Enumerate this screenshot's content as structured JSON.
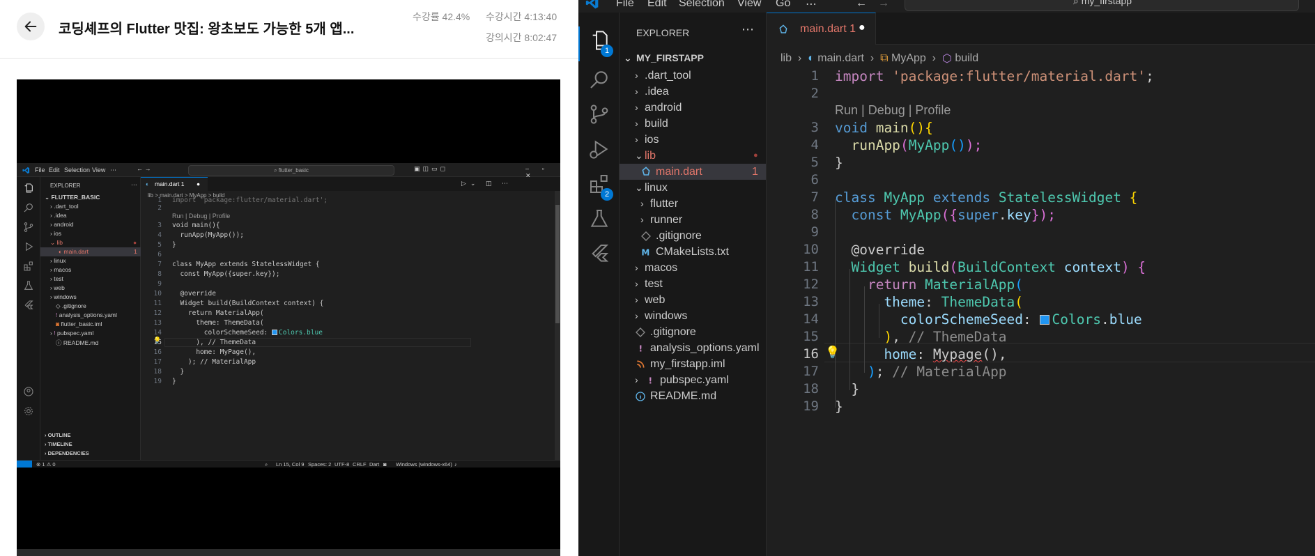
{
  "course": {
    "title": "코딩셰프의 Flutter 맛집: 왕초보도 가능한 5개 앱...",
    "progress_label": "수강률 42.4%",
    "watch_time_label": "수강시간 4:13:40",
    "lecture_time_label": "강의시간 8:02:47"
  },
  "video": {
    "menu": [
      "File",
      "Edit",
      "Selection",
      "View",
      "⋯"
    ],
    "search": "flutter_basic",
    "explorer_label": "EXPLORER",
    "project": "FLUTTER_BASIC",
    "tree": [
      ".dart_tool",
      ".idea",
      "android",
      "ios",
      "lib",
      "main.dart",
      "linux",
      "macos",
      "test",
      "web",
      "windows",
      ".gitignore",
      "analysis_options.yaml",
      "flutter_basic.iml",
      "pubspec.yaml",
      "README.md"
    ],
    "panels": [
      "OUTLINE",
      "TIMELINE",
      "DEPENDENCIES"
    ],
    "tab_label": "main.dart 1",
    "breadcrumb": "lib > main.dart > MyApp > build",
    "badge": "1",
    "codelens": "Run | Debug | Profile",
    "line_numbers": [
      "1",
      "2",
      "3",
      "4",
      "5",
      "6",
      "7",
      "8",
      "9",
      "10",
      "11",
      "12",
      "13",
      "14",
      "15",
      "16",
      "17",
      "18",
      "19"
    ],
    "code_top": "import 'package:flutter/material.dart';",
    "code": {
      "l3": "void main(){",
      "l4": "  runApp(MyApp());",
      "l5": "}",
      "l7": "class MyApp extends StatelessWidget {",
      "l8": "  const MyApp({super.key});",
      "l10": "  @override",
      "l11": "  Widget build(BuildContext context) {",
      "l12": "    return MaterialApp(",
      "l13": "      theme: ThemeData(",
      "l14a": "        colorSchemeSeed: ",
      "l14b": "Colors.blue",
      "l15": "      ), // ThemeData",
      "l16": "      home: MyPage(),",
      "l17": "    ); // MaterialApp",
      "l18": "  }",
      "l19": "}"
    },
    "status": {
      "errors": "⊗ 1 ⚠ 0",
      "position": "Ln 15, Col 9",
      "spaces": "Spaces: 2",
      "encoding": "UTF-8",
      "eol": "CRLF",
      "language": "Dart",
      "platform": "Windows (windows-x64)"
    }
  },
  "editor": {
    "menu": [
      "File",
      "Edit",
      "Selection",
      "View",
      "Go",
      "⋯"
    ],
    "search": "my_firstapp",
    "explorer_label": "EXPLORER",
    "project": "MY_FIRSTAPP",
    "tree": [
      {
        "label": ".dart_tool",
        "type": "folder",
        "depth": 1
      },
      {
        "label": ".idea",
        "type": "folder",
        "depth": 1
      },
      {
        "label": "android",
        "type": "folder",
        "depth": 1
      },
      {
        "label": "build",
        "type": "folder",
        "depth": 1
      },
      {
        "label": "ios",
        "type": "folder",
        "depth": 1
      },
      {
        "label": "lib",
        "type": "folder-open",
        "depth": 1
      },
      {
        "label": "main.dart",
        "type": "dart",
        "depth": 2,
        "badge": "1"
      },
      {
        "label": "linux",
        "type": "folder-open",
        "depth": 1
      },
      {
        "label": "flutter",
        "type": "folder",
        "depth": 2
      },
      {
        "label": "runner",
        "type": "folder",
        "depth": 2
      },
      {
        "label": ".gitignore",
        "type": "git",
        "depth": 2
      },
      {
        "label": "CMakeLists.txt",
        "type": "cmake",
        "depth": 2
      },
      {
        "label": "macos",
        "type": "folder",
        "depth": 1
      },
      {
        "label": "test",
        "type": "folder",
        "depth": 1
      },
      {
        "label": "web",
        "type": "folder",
        "depth": 1
      },
      {
        "label": "windows",
        "type": "folder",
        "depth": 1
      },
      {
        "label": ".gitignore",
        "type": "git",
        "depth": 1
      },
      {
        "label": "analysis_options.yaml",
        "type": "yaml",
        "depth": 1
      },
      {
        "label": "my_firstapp.iml",
        "type": "rss",
        "depth": 1
      },
      {
        "label": "pubspec.yaml",
        "type": "yaml-folder",
        "depth": 1
      },
      {
        "label": "README.md",
        "type": "info",
        "depth": 1
      }
    ],
    "tab_label": "main.dart 1",
    "activity_badges": [
      "1",
      "2"
    ],
    "breadcrumb": [
      "lib",
      "main.dart",
      "MyApp",
      "build"
    ],
    "codelens": "Run | Debug | Profile",
    "line_numbers": [
      "1",
      "2",
      "3",
      "4",
      "5",
      "6",
      "7",
      "8",
      "9",
      "10",
      "11",
      "12",
      "13",
      "14",
      "15",
      "16",
      "17",
      "18",
      "19"
    ],
    "code": {
      "l1a": "import ",
      "l1b": "'package:flutter/material.dart'",
      "l1c": ";",
      "l3a": "void ",
      "l3b": "main",
      "l3c": "(){",
      "l4a": "  ",
      "l4b": "runApp",
      "l4c": "(",
      "l4d": "MyApp",
      "l4e": "()",
      "l4f": ");",
      "l5": "}",
      "l7a": "class ",
      "l7b": "MyApp",
      "l7c": " extends ",
      "l7d": "StatelessWidget",
      "l7e": " {",
      "l8a": "  const ",
      "l8b": "MyApp",
      "l8c": "({",
      "l8d": "super",
      "l8e": ".",
      "l8f": "key",
      "l8g": "});",
      "l10": "  @override",
      "l11a": "  Widget ",
      "l11b": "build",
      "l11c": "(",
      "l11d": "BuildContext",
      "l11e": " context",
      "l11f": ") {",
      "l12a": "    return ",
      "l12b": "MaterialApp",
      "l12c": "(",
      "l13a": "      theme",
      "l13b": ": ",
      "l13c": "ThemeData",
      "l13d": "(",
      "l14a": "        colorSchemeSeed",
      "l14b": ": ",
      "l14c": "Colors",
      "l14d": ".",
      "l14e": "blue",
      "l15a": "      )",
      "l15b": ", ",
      "l15c": "// ThemeData",
      "l16a": "      home",
      "l16b": ": ",
      "l16c": "Mypage",
      "l16d": "(),",
      "l17a": "    )",
      "l17b": "; ",
      "l17c": "// MaterialApp",
      "l18": "  }",
      "l19": "}"
    }
  }
}
